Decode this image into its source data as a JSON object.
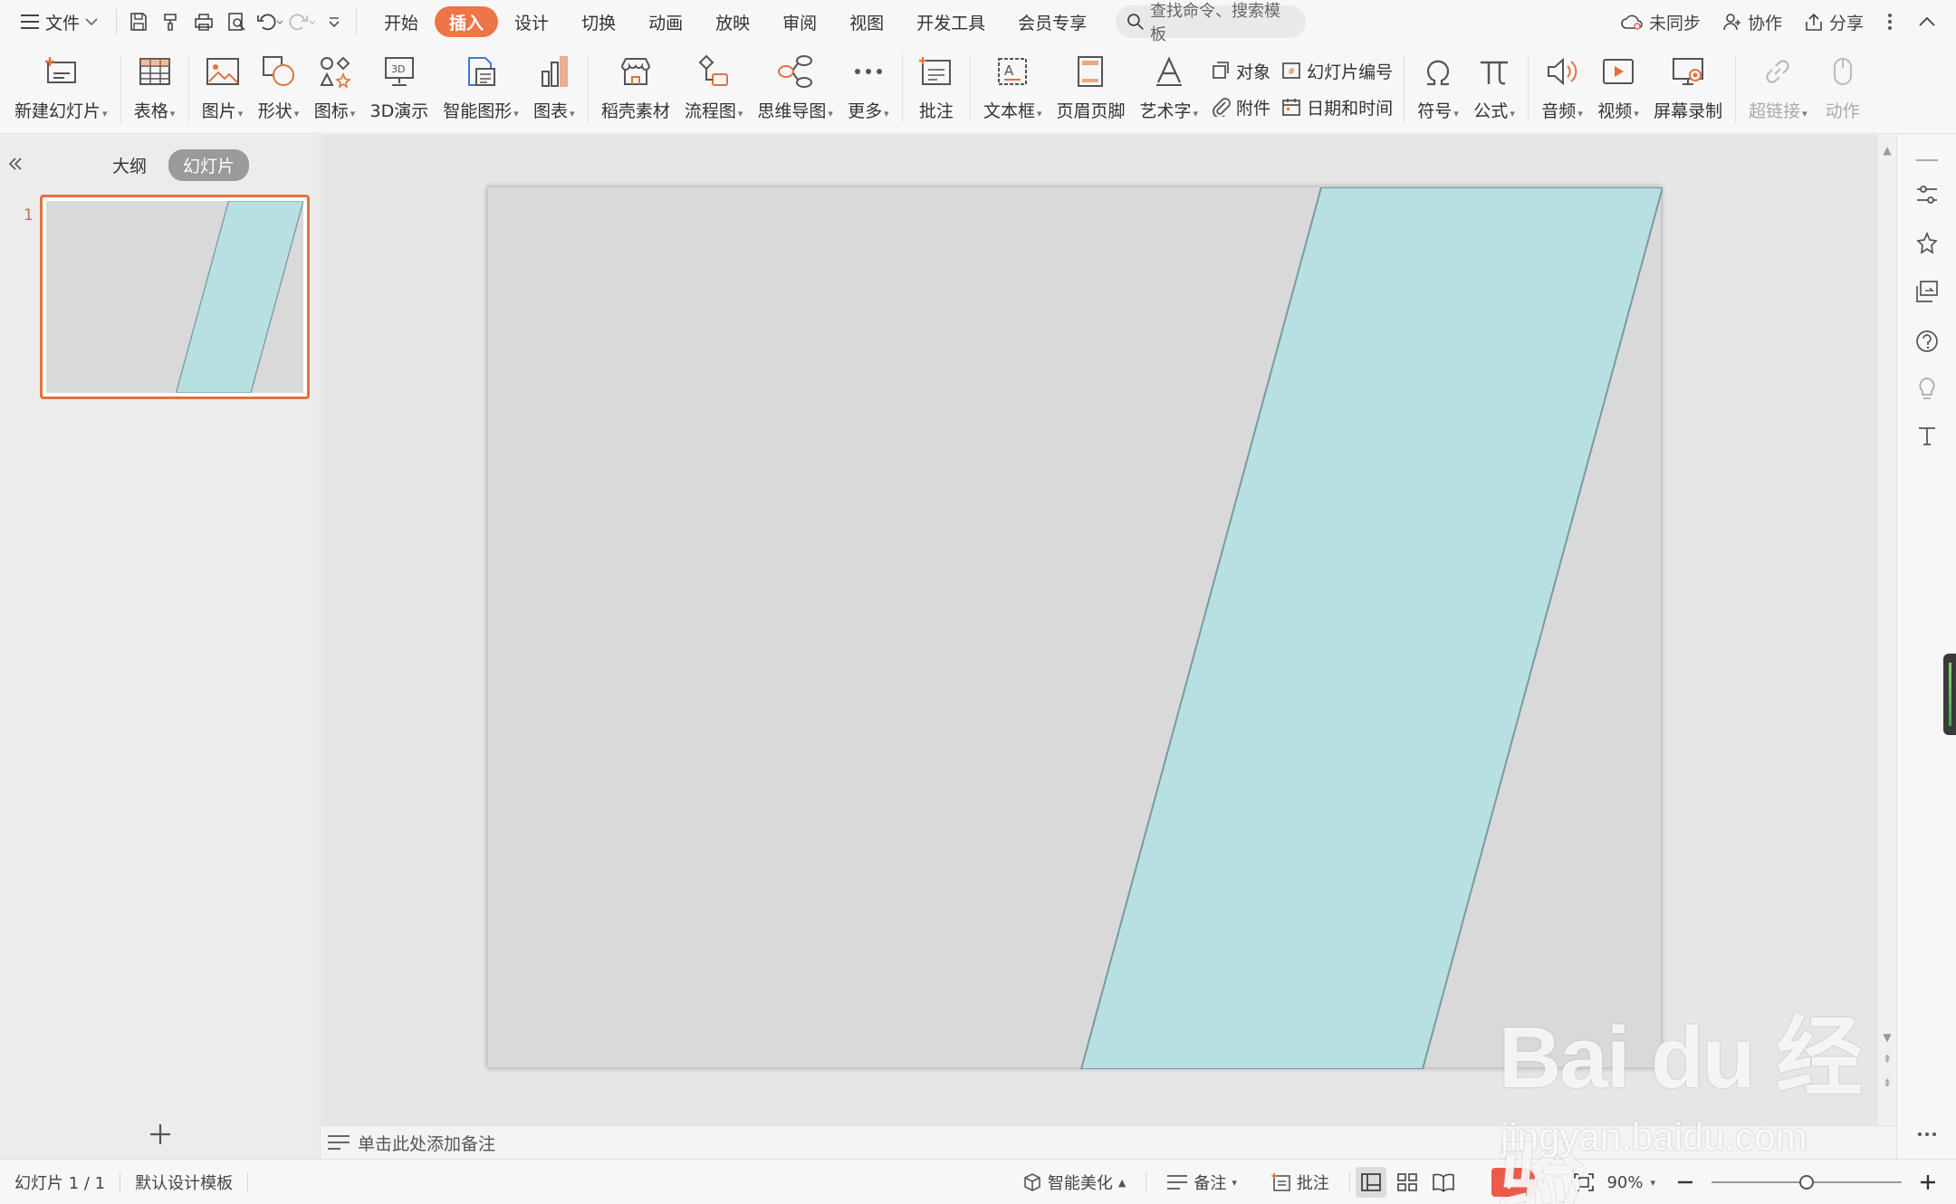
{
  "menubar": {
    "file_label": "文件",
    "tabs": [
      "开始",
      "插入",
      "设计",
      "切换",
      "动画",
      "放映",
      "审阅",
      "视图",
      "开发工具",
      "会员专享"
    ],
    "active_tab": "插入",
    "search_placeholder": "查找命令、搜索模板",
    "sync_label": "未同步",
    "collab_label": "协作",
    "share_label": "分享"
  },
  "ribbon": {
    "new_slide": "新建幻灯片",
    "table": "表格",
    "picture": "图片",
    "shape": "形状",
    "icon": "图标",
    "demo3d": "3D演示",
    "smartart": "智能图形",
    "chart": "图表",
    "daoke": "稻壳素材",
    "flowchart": "流程图",
    "mindmap": "思维导图",
    "more": "更多",
    "comment": "批注",
    "textbox": "文本框",
    "header_footer": "页眉页脚",
    "wordart": "艺术字",
    "object": "对象",
    "slide_number": "幻灯片编号",
    "attachment": "附件",
    "date_time": "日期和时间",
    "symbol": "符号",
    "formula": "公式",
    "audio": "音频",
    "video": "视频",
    "screen_record": "屏幕录制",
    "hyperlink": "超链接",
    "action": "动作"
  },
  "leftpanel": {
    "tab_outline": "大纲",
    "tab_slides": "幻灯片",
    "slide_number": "1"
  },
  "slide": {
    "background": "#d9d9d9",
    "shape_fill": "#b8dfe2",
    "shape_stroke": "#7a9aa0"
  },
  "notes": {
    "placeholder": "单击此处添加备注"
  },
  "statusbar": {
    "slide_info": "幻灯片 1 / 1",
    "template": "默认设计模板",
    "beautify": "智能美化",
    "notes": "备注",
    "comments": "批注",
    "zoom": "90%",
    "zoom_level": 0.5
  },
  "watermark": {
    "brand": "Bai du 经验",
    "url": "jingyan.baidu.com"
  },
  "colors": {
    "accent": "#ee7547",
    "play": "#ee5a4a"
  }
}
